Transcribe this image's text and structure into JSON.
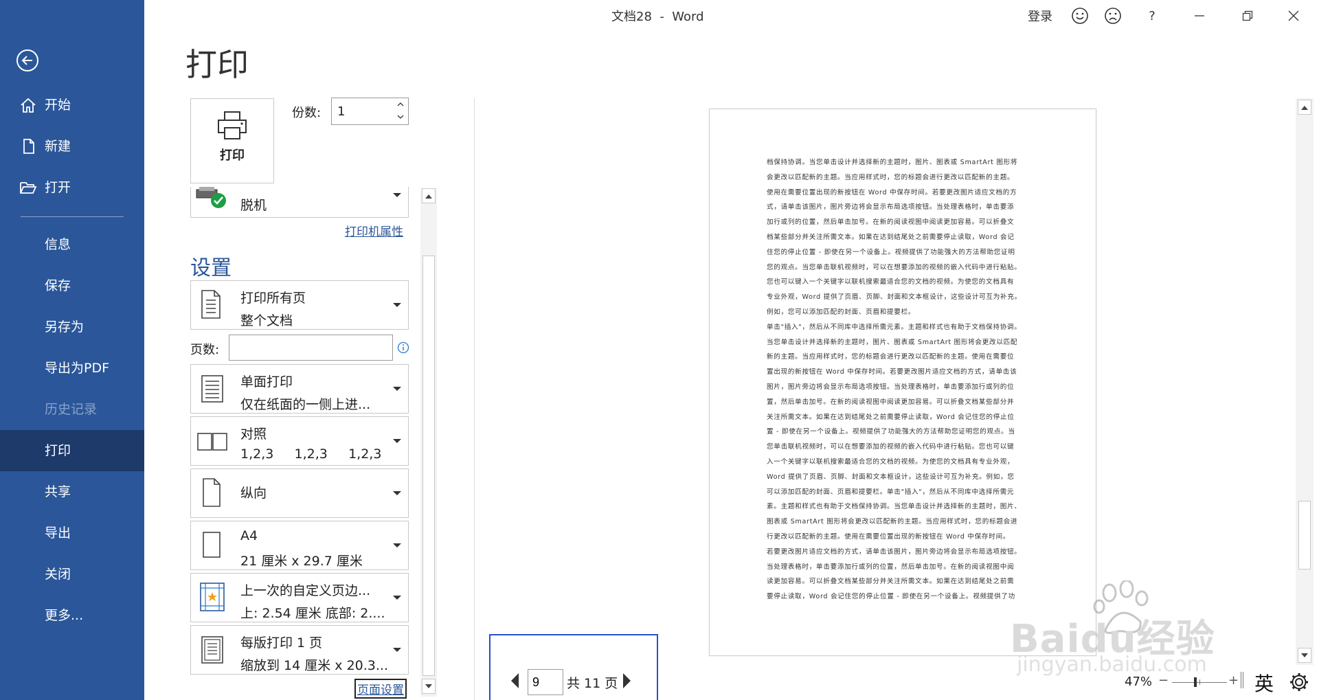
{
  "titlebar": {
    "title": "文档28  -  Word",
    "signin": "登录",
    "icons": [
      "smile-icon",
      "frown-icon",
      "help-icon",
      "minimize-icon",
      "restore-icon",
      "close-icon"
    ],
    "help_label": "?"
  },
  "sidebar": {
    "back": "back-arrow-icon",
    "items": [
      {
        "label": "开始",
        "icon": "home-icon"
      },
      {
        "label": "新建",
        "icon": "new-doc-icon"
      },
      {
        "label": "打开",
        "icon": "folder-open-icon"
      },
      {
        "label": "信息"
      },
      {
        "label": "保存"
      },
      {
        "label": "另存为"
      },
      {
        "label": "导出为PDF"
      },
      {
        "label": "历史记录",
        "state": "disabled"
      },
      {
        "label": "打印",
        "state": "active"
      },
      {
        "label": "共享"
      },
      {
        "label": "导出"
      },
      {
        "label": "关闭"
      },
      {
        "label": "更多..."
      }
    ]
  },
  "page_title": "打印",
  "print_button": "打印",
  "copies": {
    "label": "份数:",
    "value": "1"
  },
  "printer": {
    "name": "脱机",
    "properties_link": "打印机属性"
  },
  "settings": {
    "heading": "设置",
    "range": {
      "line1": "打印所有页",
      "line2": "整个文档"
    },
    "pages": {
      "label": "页数:",
      "value": "",
      "info_icon": "info-icon"
    },
    "sides": {
      "line1": "单面打印",
      "line2": "仅在纸面的一侧上进..."
    },
    "collate": {
      "line1": "对照",
      "line2": "1,2,3     1,2,3     1,2,3"
    },
    "orientation": {
      "line1": "纵向"
    },
    "paper": {
      "line1": "A4",
      "line2": "21 厘米 x 29.7 厘米"
    },
    "margins": {
      "line1": "上一次的自定义页边...",
      "line2": "上: 2.54 厘米 底部: 2...."
    },
    "pages_per_sheet": {
      "line1": "每版打印 1 页",
      "line2": "缩放到 14 厘米 x 20.3..."
    },
    "page_setup_link": "页面设置"
  },
  "preview": {
    "lines": [
      "档保持协调。当您单击设计并选择新的主题时，图片、图表或 SmartArt 图形将",
      "会更改以匹配新的主题。当应用样式时，您的标题会进行更改以匹配新的主题。",
      "使用在需要位置出现的新按钮在 Word 中保存时间。若要更改图片适应文档的方",
      "式，请单击该图片，图片旁边将会显示布局选项按钮。当处理表格时，单击要添",
      "加行或列的位置，然后单击加号。在新的阅读视图中阅读更加容易。可以折叠文",
      "档某些部分并关注所需文本。如果在达到结尾处之前需要停止读取，Word 会记",
      "住您的停止位置 - 即使在另一个设备上。视频提供了功能强大的方法帮助您证明",
      "您的观点。当您单击联机视频时，可以在想要添加的视频的嵌入代码中进行粘贴。",
      "您也可以键入一个关键字以联机搜索最适合您的文档的视频。为使您的文档具有",
      "专业外观，Word 提供了页眉、页脚、封面和文本框设计，这些设计可互为补充。",
      "例如，您可以添加匹配的封面、页眉和提要栏。",
      "单击\"插入\"，然后从不同库中选择所需元素。主题和样式也有助于文档保持协调。",
      "当您单击设计并选择新的主题时，图片、图表或 SmartArt 图形将会更改以匹配",
      "新的主题。当应用样式时，您的标题会进行更改以匹配新的主题。使用在需要位",
      "置出现的新按钮在 Word 中保存时间。若要更改图片适应文档的方式，请单击该",
      "图片，图片旁边将会显示布局选项按钮。当处理表格时，单击要添加行或列的位",
      "置，然后单击加号。在新的阅读视图中阅读更加容易。可以折叠文档某些部分并",
      "关注所需文本。如果在达到结尾处之前需要停止读取，Word 会记住您的停止位",
      "置 - 即使在另一个设备上。视频提供了功能强大的方法帮助您证明您的观点。当",
      "您单击联机视频时，可以在想要添加的视频的嵌入代码中进行粘贴。您也可以键",
      "入一个关键字以联机搜索最适合您的文档的视频。为使您的文档具有专业外观，",
      "Word 提供了页眉、页脚、封面和文本框设计，这些设计可互为补充。例如，您",
      "可以添加匹配的封面、页眉和提要栏。单击\"插入\"，然后从不同库中选择所需元",
      "素。主题和样式也有助于文档保持协调。当您单击设计并选择新的主题时，图片、",
      "图表或 SmartArt 图形将会更改以匹配新的主题。当应用样式时，您的标题会进",
      "行更改以匹配新的主题。使用在需要位置出现的新按钮在 Word 中保存时间。",
      "若要更改图片适应文档的方式，请单击该图片，图片旁边将会显示布局选项按钮。",
      "当处理表格时，单击要添加行或列的位置，然后单击加号。在新的阅读视图中阅",
      "读更加容易。可以折叠文档某些部分并关注所需文本。如果在达到结尾处之前需",
      "要停止读取，Word 会记住您的停止位置 - 即使在另一个设备上。视频提供了功"
    ]
  },
  "pager": {
    "current": "9",
    "total": "共 11 页"
  },
  "status": {
    "zoom": "47%",
    "minus": "−",
    "plus": "+",
    "ime": "英"
  },
  "watermark": {
    "text": "Baidu经验",
    "sub": "jingyan.baidu.com"
  }
}
